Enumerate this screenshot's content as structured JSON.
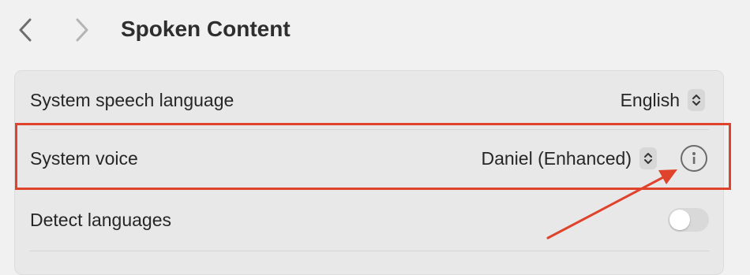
{
  "header": {
    "title": "Spoken Content",
    "back_icon": "chevron-left-icon",
    "forward_icon": "chevron-right-icon"
  },
  "settings": {
    "speech_language": {
      "label": "System speech language",
      "value": "English"
    },
    "system_voice": {
      "label": "System voice",
      "value": "Daniel (Enhanced)",
      "info_icon": "info-icon"
    },
    "detect_languages": {
      "label": "Detect languages",
      "enabled": false
    }
  },
  "annotation": {
    "highlight_color": "#e0432c",
    "target": "info-icon"
  }
}
